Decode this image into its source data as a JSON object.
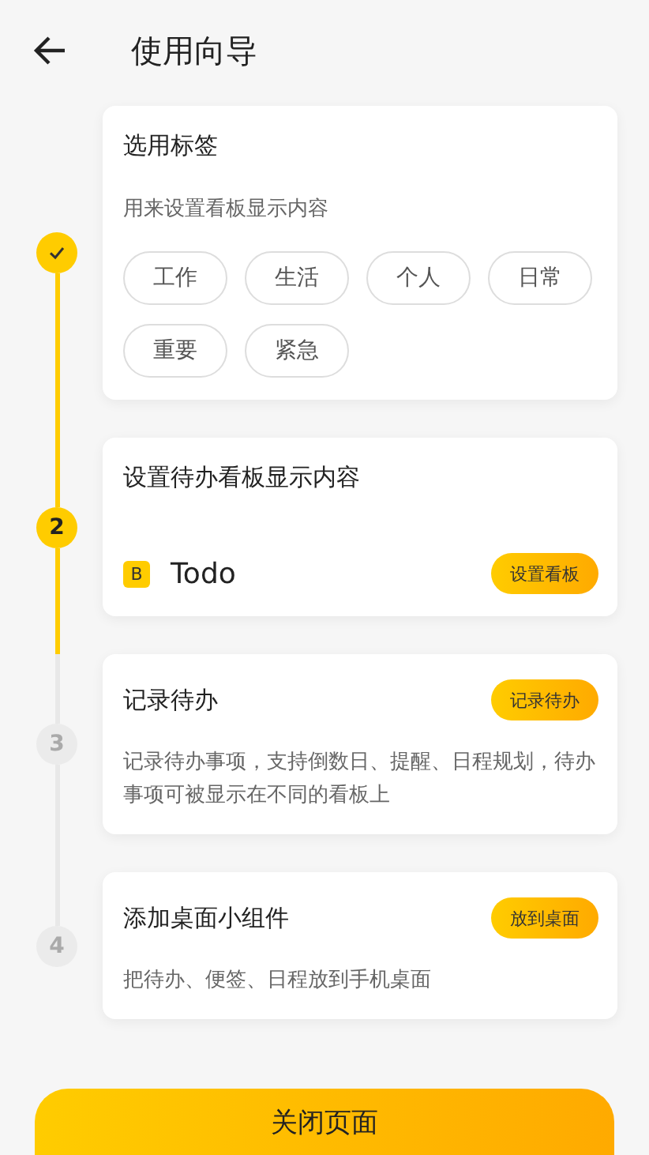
{
  "header": {
    "title": "使用向导"
  },
  "steps": [
    {
      "kind": "tags",
      "done": true,
      "current": false,
      "title": "选用标签",
      "description": "用来设置看板显示内容",
      "tags": [
        "工作",
        "生活",
        "个人",
        "日常",
        "重要",
        "紧急"
      ]
    },
    {
      "kind": "board",
      "done": false,
      "current": true,
      "number": "2",
      "title": "设置待办看板显示内容",
      "board": {
        "badge": "B",
        "name": "Todo"
      },
      "action": "设置看板"
    },
    {
      "kind": "action",
      "done": false,
      "current": false,
      "number": "3",
      "title": "记录待办",
      "action": "记录待办",
      "description": "记录待办事项，支持倒数日、提醒、日程规划，待办事项可被显示在不同的看板上"
    },
    {
      "kind": "action",
      "done": false,
      "current": false,
      "number": "4",
      "title": "添加桌面小组件",
      "action": "放到桌面",
      "description": "把待办、便签、日程放到手机桌面"
    }
  ],
  "close_button": "关闭页面"
}
